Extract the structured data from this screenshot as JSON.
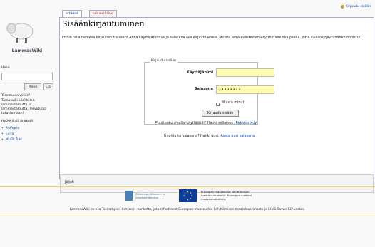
{
  "personal": {
    "login_link": "Kirjaudu sisään"
  },
  "logo": {
    "text": "LammasWiki"
  },
  "sidebar": {
    "search_label": "Haku",
    "go_button": "Mene",
    "search_button": "Etsi",
    "note_title": "Tervetuloa wikiin!",
    "note_text": "Tämä wiki käsittelee lammastaloutta ja lammastaloutta. Tervetuloa tutustumaan!",
    "links_title": "Hyödyllisiä linkkejä",
    "links": [
      "ProAgria",
      "Evira",
      "MLOY Tuki"
    ]
  },
  "tabs": {
    "article": "artikkeli",
    "new_page": "luo uusi sivu"
  },
  "page": {
    "title": "Sisäänkirjautuminen",
    "intro": "Et ole tällä hetkellä kirjautunut sisään! Anna käyttäjätunnus ja salasana alla kirjautuaksesi. Muista, että evästeiden käyttö tulee olla päällä, jotta sisäänkirjautuminen onnistuu."
  },
  "login": {
    "legend": "Kirjaudu sisään",
    "username_label": "Käyttäjänimi",
    "username_value": "",
    "password_label": "Salasana",
    "password_value": "••••••••",
    "remember_label": "Muista minut",
    "submit": "Kirjaudu sisään",
    "register_prompt": "Puuttuuko sinulta käyttäjätili? Hanki sellainen:",
    "register_link": "Rekisteröidy",
    "forgot_prompt": "Unohtuiko salasana? Hanki uusi:",
    "forgot_link": "Aseta uusi salasana"
  },
  "catlinks": {
    "label": "Jäljet:"
  },
  "footer": {
    "logo1_text": "Elinkeino-, liikenne- ja ympäristökeskus",
    "eu_text": "Euroopan maaseudun kehittämisen maatalousrahasto: Eurooppa investoi maaseutualueisiin",
    "note": "LammasWiki on osa Tositampien tietoisen -hanketta, jota rahoittavat Euroopan maaseudun kehittämisen maatalousrahasto ja Etelä-Savon ELY-keskus."
  },
  "colors": {
    "link": "#0645ad",
    "field_bg": "#fffdb0",
    "footer_rule": "#f5cf60"
  }
}
